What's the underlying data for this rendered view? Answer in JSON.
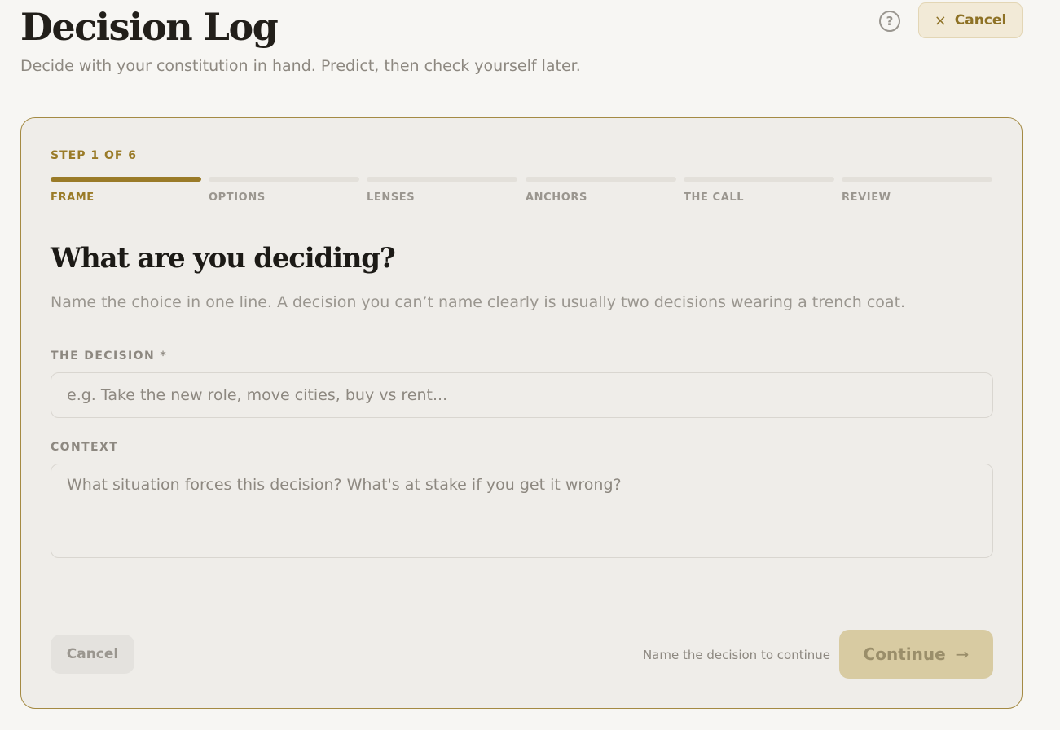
{
  "header": {
    "title": "Decision Log",
    "subtitle": "Decide with your constitution in hand. Predict, then check yourself later.",
    "help_icon": "?",
    "cancel_label": "Cancel",
    "cancel_icon": "×"
  },
  "wizard": {
    "step_label": "STEP 1 OF 6",
    "steps": [
      {
        "label": "FRAME",
        "active": true
      },
      {
        "label": "OPTIONS",
        "active": false
      },
      {
        "label": "LENSES",
        "active": false
      },
      {
        "label": "ANCHORS",
        "active": false
      },
      {
        "label": "THE CALL",
        "active": false
      },
      {
        "label": "REVIEW",
        "active": false
      }
    ],
    "question": "What are you deciding?",
    "question_help": "Name the choice in one line. A decision you can’t name clearly is usually two decisions wearing a trench coat.",
    "decision_label": "THE DECISION *",
    "decision_value": "",
    "decision_placeholder": "e.g. Take the new role, move cities, buy vs rent...",
    "context_label": "CONTEXT",
    "context_value": "",
    "context_placeholder": "What situation forces this decision? What's at stake if you get it wrong?"
  },
  "footer": {
    "cancel_label": "Cancel",
    "hint": "Name the decision to continue",
    "continue_label": "Continue",
    "continue_icon": "→"
  },
  "colors": {
    "accent": "#9a7b28",
    "background": "#f7f6f3",
    "card": "#efede9",
    "continue_disabled": "#d8cba2"
  }
}
